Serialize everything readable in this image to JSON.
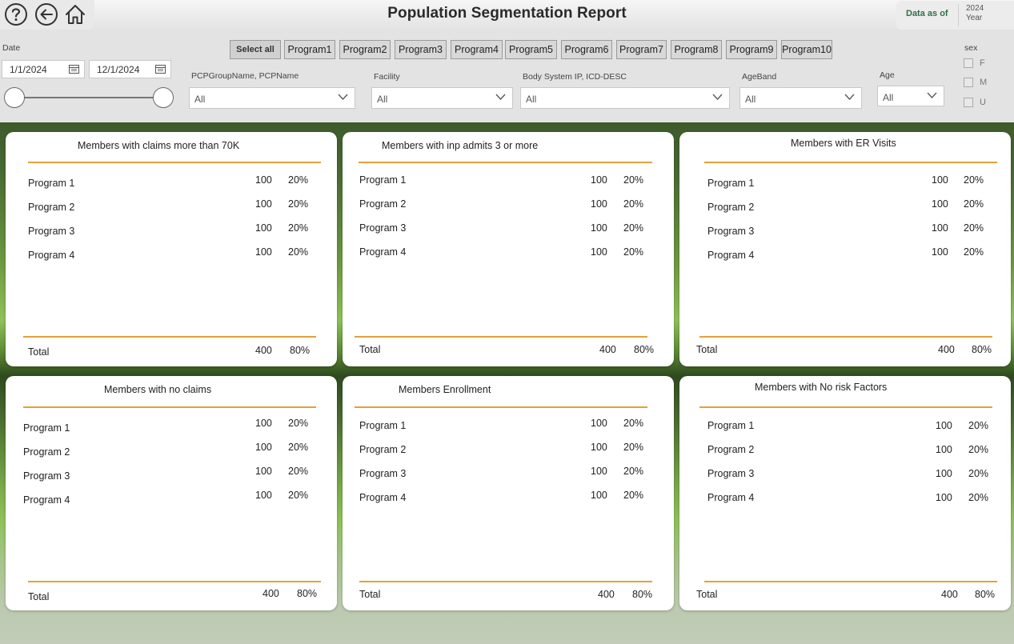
{
  "header": {
    "title": "Population Segmentation Report",
    "data_as_of_label": "Data as of",
    "data_as_of_year": "2024",
    "data_as_of_sub": "Year"
  },
  "filters": {
    "date_label": "Date",
    "date_start": "1/1/2024",
    "date_end": "12/1/2024",
    "select_all_label": "Select all",
    "programs": [
      "Program1",
      "Program2",
      "Program3",
      "Program4",
      "Program5",
      "Program6",
      "Program7",
      "Program8",
      "Program9",
      "Program10"
    ],
    "pcp_label": "PCPGroupName, PCPName",
    "pcp_value": "All",
    "facility_label": "Facility",
    "facility_value": "All",
    "body_system_label": "Body System IP, ICD-DESC",
    "body_system_value": "All",
    "ageband_label": "AgeBand",
    "ageband_value": "All",
    "age_label": "Age",
    "age_value": "All",
    "sex_label": "sex",
    "sex_options": [
      "F",
      "M",
      "U"
    ]
  },
  "cards": [
    {
      "title": "Members with claims more than 70K",
      "rows": [
        {
          "label": "Program 1",
          "count": "100",
          "pct": "20%"
        },
        {
          "label": "Program 2",
          "count": "100",
          "pct": "20%"
        },
        {
          "label": "Program 3",
          "count": "100",
          "pct": "20%"
        },
        {
          "label": "Program 4",
          "count": "100",
          "pct": "20%"
        }
      ],
      "total_label": "Total",
      "total_count": "400",
      "total_pct": "80%"
    },
    {
      "title": "Members with inp admits 3 or more",
      "rows": [
        {
          "label": "Program 1",
          "count": "100",
          "pct": "20%"
        },
        {
          "label": "Program 2",
          "count": "100",
          "pct": "20%"
        },
        {
          "label": "Program 3",
          "count": "100",
          "pct": "20%"
        },
        {
          "label": "Program 4",
          "count": "100",
          "pct": "20%"
        }
      ],
      "total_label": "Total",
      "total_count": "400",
      "total_pct": "80%"
    },
    {
      "title": "Members with ER Visits",
      "rows": [
        {
          "label": "Program 1",
          "count": "100",
          "pct": "20%"
        },
        {
          "label": "Program 2",
          "count": "100",
          "pct": "20%"
        },
        {
          "label": "Program 3",
          "count": "100",
          "pct": "20%"
        },
        {
          "label": "Program 4",
          "count": "100",
          "pct": "20%"
        }
      ],
      "total_label": "Total",
      "total_count": "400",
      "total_pct": "80%"
    },
    {
      "title": "Members with  no claims",
      "rows": [
        {
          "label": "Program 1",
          "count": "100",
          "pct": "20%"
        },
        {
          "label": "Program 2",
          "count": "100",
          "pct": "20%"
        },
        {
          "label": "Program 3",
          "count": "100",
          "pct": "20%"
        },
        {
          "label": "Program 4",
          "count": "100",
          "pct": "20%"
        }
      ],
      "total_label": "Total",
      "total_count": "400",
      "total_pct": "80%"
    },
    {
      "title": "Members Enrollment",
      "rows": [
        {
          "label": "Program 1",
          "count": "100",
          "pct": "20%"
        },
        {
          "label": "Program 2",
          "count": "100",
          "pct": "20%"
        },
        {
          "label": "Program 3",
          "count": "100",
          "pct": "20%"
        },
        {
          "label": "Program 4",
          "count": "100",
          "pct": "20%"
        }
      ],
      "total_label": "Total",
      "total_count": "400",
      "total_pct": "80%"
    },
    {
      "title": "Members with No risk Factors",
      "rows": [
        {
          "label": "Program 1",
          "count": "100",
          "pct": "20%"
        },
        {
          "label": "Program 2",
          "count": "100",
          "pct": "20%"
        },
        {
          "label": "Program 3",
          "count": "100",
          "pct": "20%"
        },
        {
          "label": "Program 4",
          "count": "100",
          "pct": "20%"
        }
      ],
      "total_label": "Total",
      "total_count": "400",
      "total_pct": "80%"
    }
  ],
  "colors": {
    "accent_rule": "#e3a13b",
    "data_as_of_text": "#2f6e4b"
  },
  "icons": [
    "help-icon",
    "back-arrow-icon",
    "home-icon",
    "calendar-icon",
    "chevron-down-icon"
  ]
}
